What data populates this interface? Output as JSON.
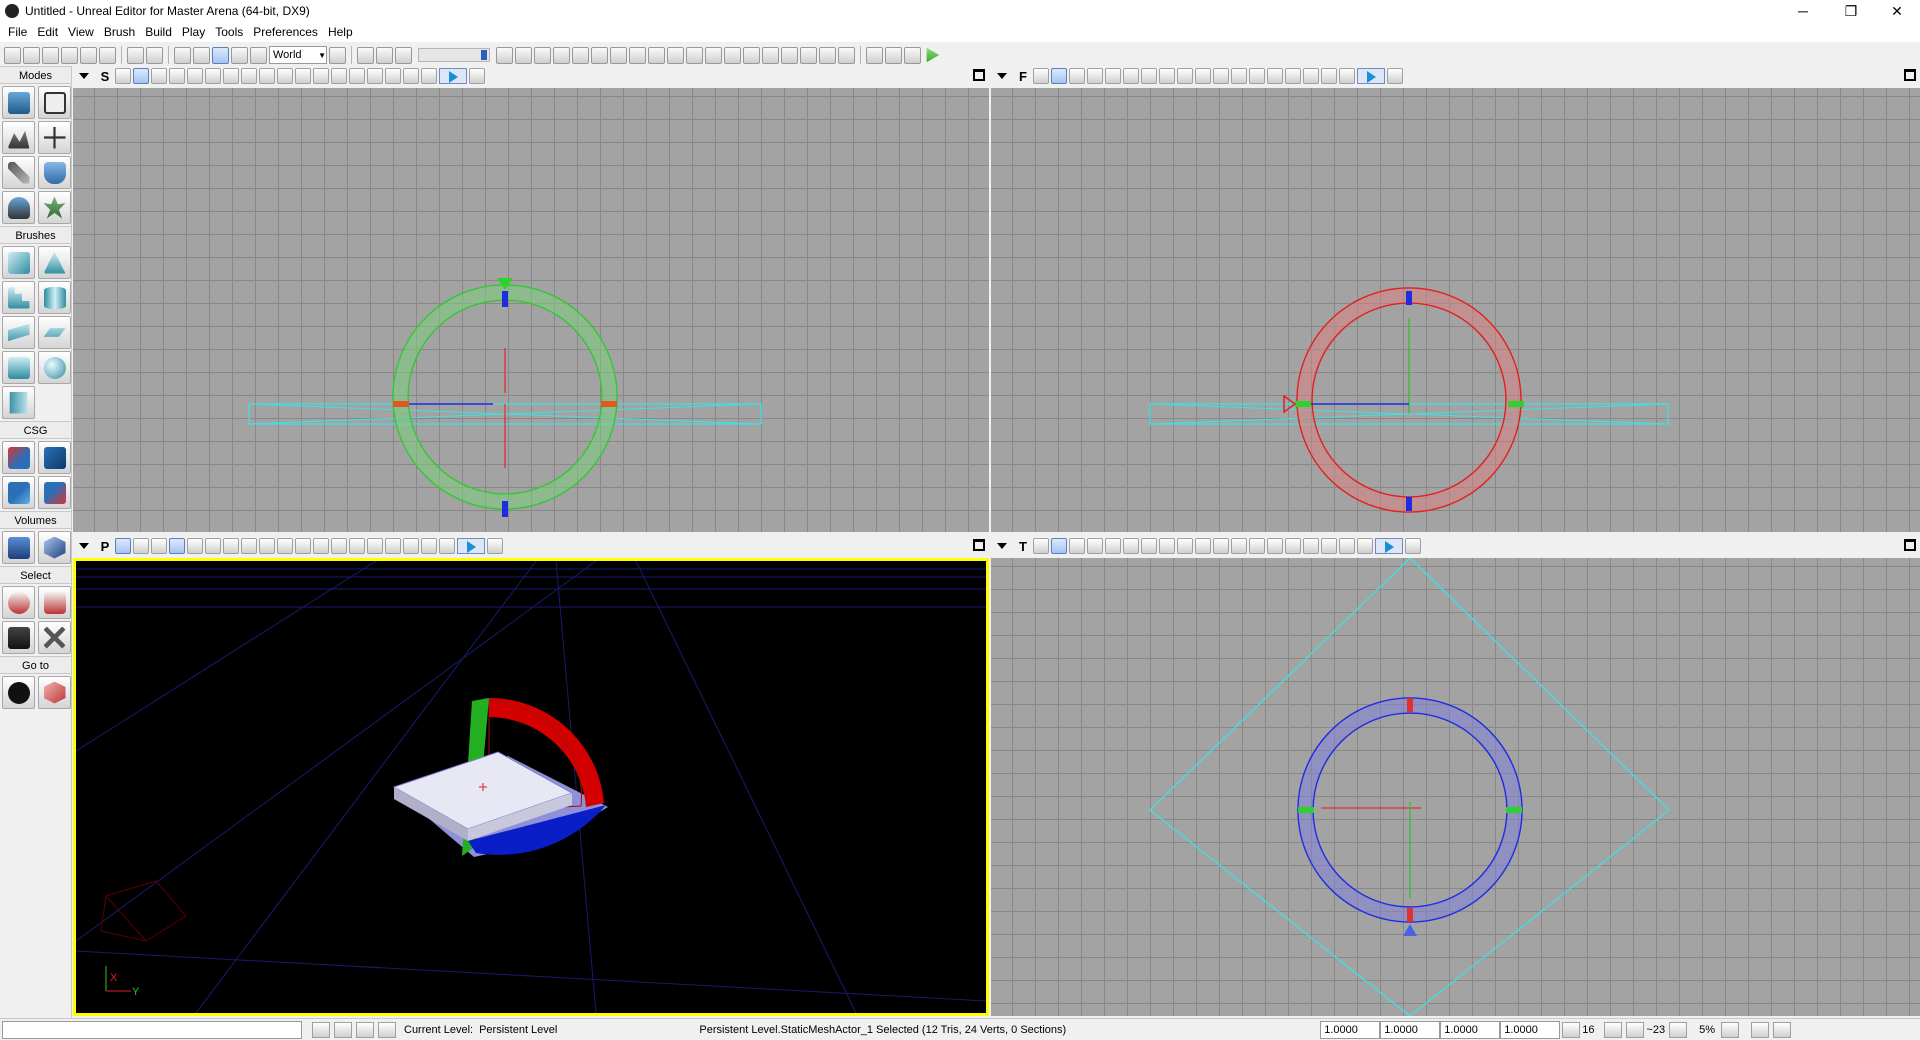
{
  "window": {
    "title": "Untitled - Unreal Editor for Master Arena (64-bit, DX9)",
    "minimize": "─",
    "maximize": "❐",
    "close": "✕"
  },
  "menu": [
    "File",
    "Edit",
    "View",
    "Brush",
    "Build",
    "Play",
    "Tools",
    "Preferences",
    "Help"
  ],
  "toolbar": {
    "coordinate_system": "World"
  },
  "left_panel": {
    "sections": {
      "modes": "Modes",
      "brushes": "Brushes",
      "csg": "CSG",
      "volumes": "Volumes",
      "select": "Select",
      "goto": "Go to"
    }
  },
  "viewports": {
    "top_left": {
      "mode_letter": "S"
    },
    "top_right": {
      "mode_letter": "F"
    },
    "bottom_left": {
      "mode_letter": "P",
      "axis_x": "X",
      "axis_y": "Y"
    },
    "bottom_right": {
      "mode_letter": "T"
    }
  },
  "statusbar": {
    "current_level_label": "Current Level:",
    "current_level_value": "Persistent Level",
    "selection_info": "Persistent Level.StaticMeshActor_1 Selected (12 Tris, 24 Verts, 0 Sections)",
    "scale_x": "1.0000",
    "scale_y": "1.0000",
    "scale_z": "1.0000",
    "scale_all": "1.0000",
    "grid_size": "16",
    "rotation_snap": "~23",
    "scale_snap": "5%"
  },
  "colors": {
    "selection_outline": "#ffff00",
    "ortho_bg": "#a3a3a3",
    "perspective_bg": "#000000",
    "wire": "#40e0e0"
  }
}
